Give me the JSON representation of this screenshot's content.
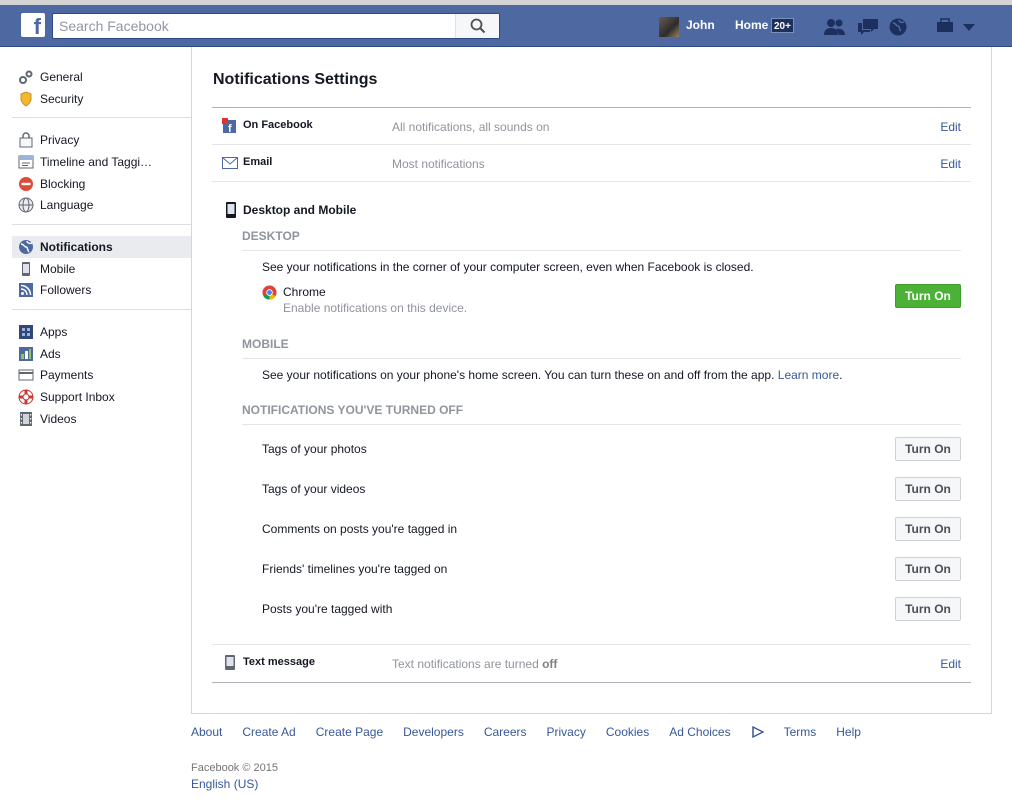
{
  "topbar": {
    "logo_letter": "f",
    "search_placeholder": "Search Facebook",
    "user_name": "John",
    "home_label": "Home",
    "home_badge": "20+"
  },
  "sidebar": {
    "groups": [
      [
        {
          "label": "General",
          "icon": "gears-icon"
        },
        {
          "label": "Security",
          "icon": "badge-icon"
        }
      ],
      [
        {
          "label": "Privacy",
          "icon": "lock-icon"
        },
        {
          "label": "Timeline and Taggi…",
          "icon": "timeline-icon"
        },
        {
          "label": "Blocking",
          "icon": "block-icon"
        },
        {
          "label": "Language",
          "icon": "globe-icon"
        }
      ],
      [
        {
          "label": "Notifications",
          "icon": "globe-notification-icon",
          "active": true
        },
        {
          "label": "Mobile",
          "icon": "phone-icon"
        },
        {
          "label": "Followers",
          "icon": "rss-icon"
        }
      ],
      [
        {
          "label": "Apps",
          "icon": "apps-icon"
        },
        {
          "label": "Ads",
          "icon": "ads-icon"
        },
        {
          "label": "Payments",
          "icon": "card-icon"
        },
        {
          "label": "Support Inbox",
          "icon": "lifebuoy-icon"
        },
        {
          "label": "Videos",
          "icon": "film-icon"
        }
      ]
    ]
  },
  "main": {
    "title": "Notifications Settings",
    "on_facebook": {
      "label": "On Facebook",
      "summary": "All notifications, all sounds on",
      "edit": "Edit"
    },
    "email": {
      "label": "Email",
      "summary": "Most notifications",
      "edit": "Edit"
    },
    "desktop_mobile": {
      "title": "Desktop and Mobile",
      "desktop_head": "DESKTOP",
      "desktop_text": "See your notifications in the corner of your computer screen, even when Facebook is closed.",
      "chrome_name": "Chrome",
      "chrome_sub": "Enable notifications on this device.",
      "chrome_button": "Turn On",
      "mobile_head": "MOBILE",
      "mobile_text": "See your notifications on your phone's home screen. You can turn these on and off from the app.",
      "learn_more": "Learn more",
      "learn_more_suffix": ".",
      "off_head": "NOTIFICATIONS YOU'VE TURNED OFF",
      "off_items": [
        {
          "label": "Tags of your photos",
          "button": "Turn On"
        },
        {
          "label": "Tags of your videos",
          "button": "Turn On"
        },
        {
          "label": "Comments on posts you're tagged in",
          "button": "Turn On"
        },
        {
          "label": "Friends' timelines you're tagged on",
          "button": "Turn On"
        },
        {
          "label": "Posts you're tagged with",
          "button": "Turn On"
        }
      ]
    },
    "text_message": {
      "label": "Text message",
      "summary": "Text notifications are turned",
      "summary_bold": "off",
      "edit": "Edit"
    }
  },
  "footer": {
    "links": [
      "About",
      "Create Ad",
      "Create Page",
      "Developers",
      "Careers",
      "Privacy",
      "Cookies",
      "Ad Choices",
      "Terms",
      "Help"
    ],
    "copyright": "Facebook © 2015",
    "language": "English (US)"
  },
  "colors": {
    "brand": "#4e69a2",
    "link": "#365899",
    "green": "#4bb237"
  }
}
